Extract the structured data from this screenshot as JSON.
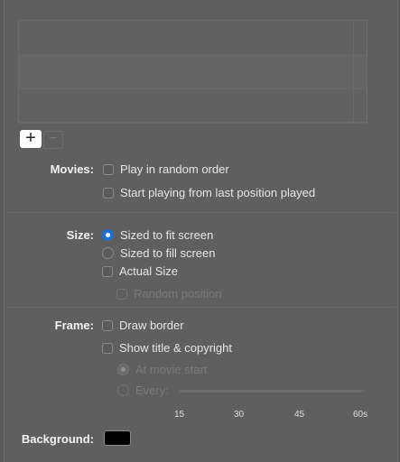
{
  "list": {
    "add_button": "+",
    "remove_button": "−"
  },
  "movies": {
    "label": "Movies:",
    "options": [
      {
        "label": "Play in random order",
        "checked": false
      },
      {
        "label": "Start playing from last position played",
        "checked": false
      }
    ]
  },
  "size": {
    "label": "Size:",
    "options": [
      {
        "label": "Sized to fit screen",
        "selected": true
      },
      {
        "label": "Sized to fill screen",
        "selected": false
      },
      {
        "label": "Actual Size",
        "checked": false
      }
    ],
    "random_position": {
      "label": "Random position",
      "enabled": false
    }
  },
  "frame": {
    "label": "Frame:",
    "options": [
      {
        "label": "Draw border",
        "checked": false
      },
      {
        "label": "Show title & copyright",
        "checked": false
      }
    ],
    "at_movie_start": {
      "label": "At movie start",
      "enabled": false
    },
    "every": {
      "label": "Every:",
      "enabled": false
    },
    "slider_ticks": [
      "15",
      "30",
      "45",
      "60s"
    ]
  },
  "background": {
    "label": "Background:",
    "color": "#000000"
  },
  "colors": {
    "accent": "#1f6fd8"
  }
}
